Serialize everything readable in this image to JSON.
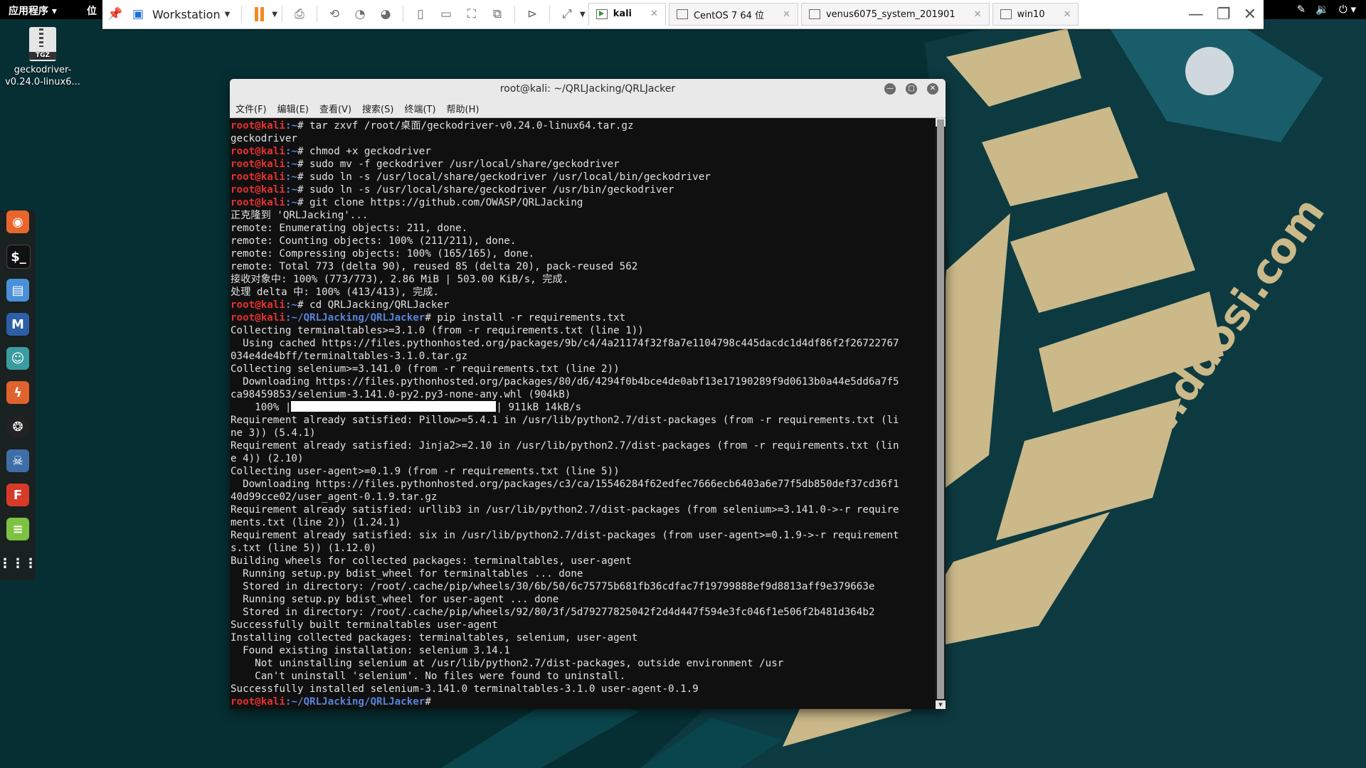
{
  "desktop": {
    "file_icon_label": "TGZ",
    "file_name": "geckodriver-v0.24.0-linux6...",
    "watermark": "www.ddosi.com"
  },
  "gnome_bar": {
    "applications": "应用程序",
    "places": "位"
  },
  "vmware": {
    "product": "Workstation",
    "tabs": [
      {
        "label": "kali",
        "active": true
      },
      {
        "label": "CentOS 7 64 位",
        "active": false
      },
      {
        "label": "venus6075_system_201901",
        "active": false
      },
      {
        "label": "win10",
        "active": false
      }
    ]
  },
  "terminal": {
    "title": "root@kali: ~/QRLJacking/QRLJacker",
    "menu": [
      "文件(F)",
      "编辑(E)",
      "查看(V)",
      "搜索(S)",
      "终端(T)",
      "帮助(H)"
    ],
    "prompt_user": "root@kali",
    "lines": [
      {
        "path": ":~",
        "cmd": "# tar zxvf /root/桌面/geckodriver-v0.24.0-linux64.tar.gz"
      },
      {
        "out": "geckodriver"
      },
      {
        "path": ":~",
        "cmd": "# chmod +x geckodriver"
      },
      {
        "path": ":~",
        "cmd": "# sudo mv -f geckodriver /usr/local/share/geckodriver"
      },
      {
        "path": ":~",
        "cmd": "# sudo ln -s /usr/local/share/geckodriver /usr/local/bin/geckodriver"
      },
      {
        "path": ":~",
        "cmd": "# sudo ln -s /usr/local/share/geckodriver /usr/bin/geckodriver"
      },
      {
        "path": ":~",
        "cmd": "# git clone https://github.com/OWASP/QRLJacking"
      },
      {
        "out": "正克隆到 'QRLJacking'..."
      },
      {
        "out": "remote: Enumerating objects: 211, done."
      },
      {
        "out": "remote: Counting objects: 100% (211/211), done."
      },
      {
        "out": "remote: Compressing objects: 100% (165/165), done."
      },
      {
        "out": "remote: Total 773 (delta 90), reused 85 (delta 20), pack-reused 562"
      },
      {
        "out": "接收对象中: 100% (773/773), 2.86 MiB | 503.00 KiB/s, 完成."
      },
      {
        "out": "处理 delta 中: 100% (413/413), 完成."
      },
      {
        "path": ":~",
        "cmd": "# cd QRLJacking/QRLJacker"
      },
      {
        "path": ":~/QRLJacking/QRLJacker",
        "cmd": "# pip install -r requirements.txt"
      },
      {
        "out": "Collecting terminaltables>=3.1.0 (from -r requirements.txt (line 1))"
      },
      {
        "out": "  Using cached https://files.pythonhosted.org/packages/9b/c4/4a21174f32f8a7e1104798c445dacdc1d4df86f2f26722767"
      },
      {
        "out": "034e4de4bff/terminaltables-3.1.0.tar.gz"
      },
      {
        "out": "Collecting selenium>=3.141.0 (from -r requirements.txt (line 2))"
      },
      {
        "out": "  Downloading https://files.pythonhosted.org/packages/80/d6/4294f0b4bce4de0abf13e17190289f9d0613b0a44e5dd6a7f5"
      },
      {
        "out": "ca98459853/selenium-3.141.0-py2.py3-none-any.whl (904kB)"
      },
      {
        "progress_pct": "    100% |",
        "progress_tail": "| 911kB 14kB/s"
      },
      {
        "out": "Requirement already satisfied: Pillow>=5.4.1 in /usr/lib/python2.7/dist-packages (from -r requirements.txt (li"
      },
      {
        "out": "ne 3)) (5.4.1)"
      },
      {
        "out": "Requirement already satisfied: Jinja2>=2.10 in /usr/lib/python2.7/dist-packages (from -r requirements.txt (lin"
      },
      {
        "out": "e 4)) (2.10)"
      },
      {
        "out": "Collecting user-agent>=0.1.9 (from -r requirements.txt (line 5))"
      },
      {
        "out": "  Downloading https://files.pythonhosted.org/packages/c3/ca/15546284f62edfec7666ecb6403a6e77f5db850def37cd36f1"
      },
      {
        "out": "40d99cce02/user_agent-0.1.9.tar.gz"
      },
      {
        "out": "Requirement already satisfied: urllib3 in /usr/lib/python2.7/dist-packages (from selenium>=3.141.0->-r require"
      },
      {
        "out": "ments.txt (line 2)) (1.24.1)"
      },
      {
        "out": "Requirement already satisfied: six in /usr/lib/python2.7/dist-packages (from user-agent>=0.1.9->-r requirement"
      },
      {
        "out": "s.txt (line 5)) (1.12.0)"
      },
      {
        "out": "Building wheels for collected packages: terminaltables, user-agent"
      },
      {
        "out": "  Running setup.py bdist_wheel for terminaltables ... done"
      },
      {
        "out": "  Stored in directory: /root/.cache/pip/wheels/30/6b/50/6c75775b681fb36cdfac7f19799888ef9d8813aff9e379663e"
      },
      {
        "out": "  Running setup.py bdist_wheel for user-agent ... done"
      },
      {
        "out": "  Stored in directory: /root/.cache/pip/wheels/92/80/3f/5d79277825042f2d4d447f594e3fc046f1e506f2b481d364b2"
      },
      {
        "out": "Successfully built terminaltables user-agent"
      },
      {
        "out": "Installing collected packages: terminaltables, selenium, user-agent"
      },
      {
        "out": "  Found existing installation: selenium 3.14.1"
      },
      {
        "out": "    Not uninstalling selenium at /usr/lib/python2.7/dist-packages, outside environment /usr"
      },
      {
        "out": "    Can't uninstall 'selenium'. No files were found to uninstall."
      },
      {
        "out": "Successfully installed selenium-3.141.0 terminaltables-3.1.0 user-agent-0.1.9"
      },
      {
        "path": ":~/QRLJacking/QRLJacker",
        "cmd": "# "
      }
    ]
  }
}
